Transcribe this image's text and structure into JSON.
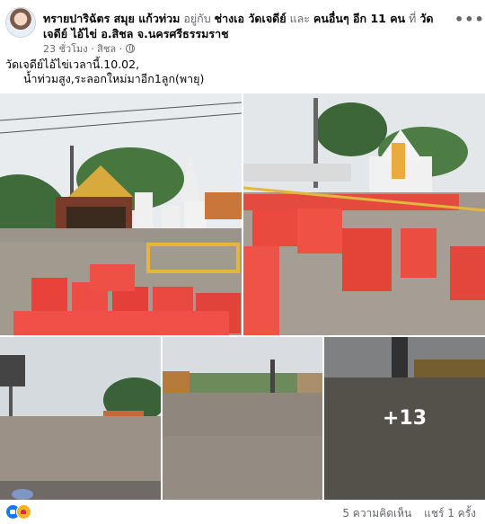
{
  "post": {
    "author": "ทรายปาริฉัตร สมุย แก้วท่วม",
    "with_word": "อยู่กับ",
    "tagged": "ช่างเอ วัดเจดีย์",
    "and_word": "และ",
    "others": "คนอื่นๆ อีก 11 คน",
    "at_word": "ที่",
    "location": "วัดเจดีย์ ไอ้ไข่ อ.สิชล จ.นครศรีธรรมราช",
    "time": "23 ชั่วโมง",
    "separator": "·",
    "privacy": "สิชล",
    "privacy_icon": "globe-icon",
    "more_label": "•••",
    "text_line1": "วัดเจดีย์ไอ้ไข่เวลานี้.10.02,",
    "text_line2": "น้ำท่วมสูง,ระลอกใหม่มาอีก1ลูก(พายุ)",
    "extra_photos": "+13",
    "reactions": [
      "like-icon",
      "care-icon"
    ],
    "comments": "5 ความคิดเห็น",
    "shares": "แชร์ 1 ครั้ง"
  }
}
